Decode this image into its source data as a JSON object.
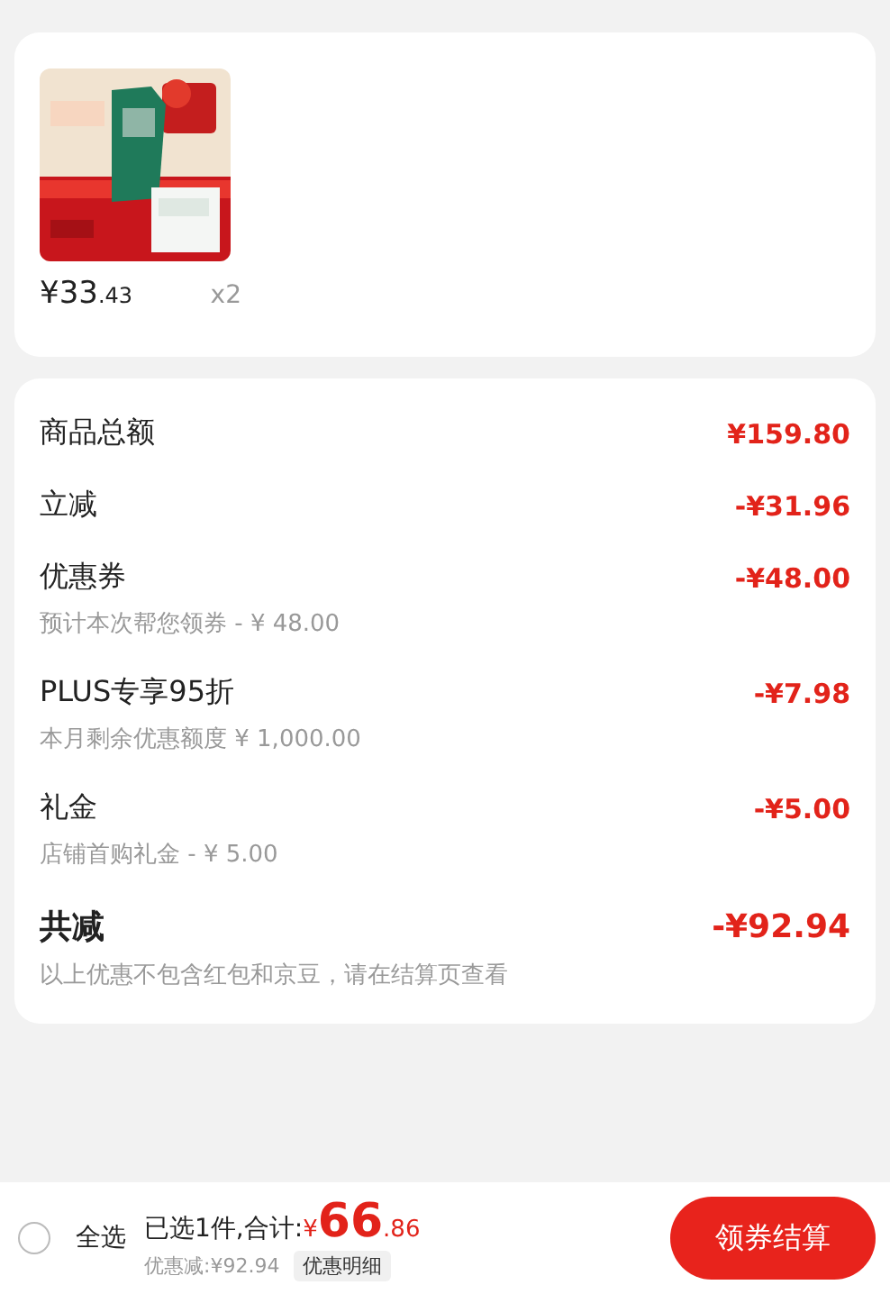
{
  "product": {
    "price_main": "¥33",
    "price_decimal": ".43",
    "quantity": "x2"
  },
  "summary": {
    "rows": [
      {
        "label": "商品总额",
        "amount": "¥159.80"
      },
      {
        "label": "立减",
        "amount": "-¥31.96"
      },
      {
        "label": "优惠券",
        "amount": "-¥48.00",
        "note": "预计本次帮您领券 - ¥ 48.00"
      },
      {
        "label": "PLUS专享95折",
        "amount": "-¥7.98",
        "note": "本月剩余优惠额度 ¥ 1,000.00"
      },
      {
        "label": "礼金",
        "amount": "-¥5.00",
        "note": "店铺首购礼金 - ¥ 5.00"
      }
    ],
    "total": {
      "label": "共减",
      "amount": "-¥92.94",
      "note": "以上优惠不包含红包和京豆，请在结算页查看"
    }
  },
  "footer": {
    "select_all": {
      "label": "全选",
      "checked": false
    },
    "selected_text": "已选1件,合计:",
    "currency": "¥",
    "total_main": "66",
    "total_decimal": ".86",
    "discount": "优惠减:¥92.94",
    "detail_button": "优惠明细",
    "checkout_button": "领券结算"
  }
}
